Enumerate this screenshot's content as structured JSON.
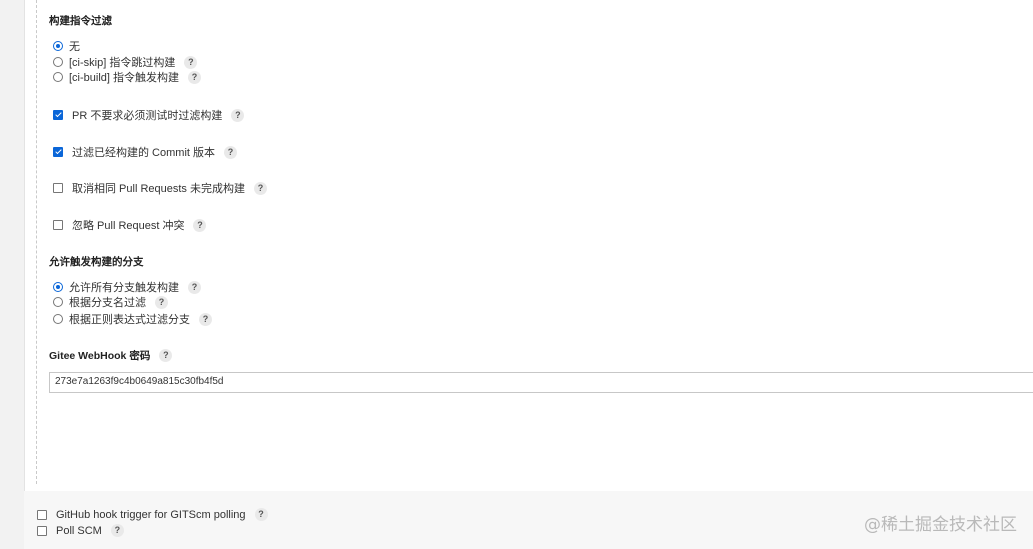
{
  "build_filter": {
    "title": "构建指令过滤",
    "options": [
      {
        "label": "无",
        "checked": true,
        "help": false
      },
      {
        "label": "[ci-skip] 指令跳过构建",
        "checked": false,
        "help": true
      },
      {
        "label": "[ci-build] 指令触发构建",
        "checked": false,
        "help": true
      }
    ]
  },
  "checkboxes": [
    {
      "label": "PR 不要求必须测试时过滤构建",
      "checked": true
    },
    {
      "label": "过滤已经构建的 Commit 版本",
      "checked": true
    },
    {
      "label": "取消相同 Pull Requests 未完成构建",
      "checked": false
    },
    {
      "label": "忽略 Pull Request 冲突",
      "checked": false
    }
  ],
  "branch_filter": {
    "title": "允许触发构建的分支",
    "options": [
      {
        "label": "允许所有分支触发构建",
        "checked": true
      },
      {
        "label": "根据分支名过滤",
        "checked": false
      },
      {
        "label": "根据正则表达式过滤分支",
        "checked": false
      }
    ]
  },
  "webhook": {
    "title": "Gitee WebHook 密码",
    "value": "273e7a1263f9c4b0649a815c30fb4f5d"
  },
  "triggers": [
    {
      "label": "GitHub hook trigger for GITScm polling",
      "checked": false
    },
    {
      "label": "Poll SCM",
      "checked": false
    }
  ],
  "help_symbol": "?",
  "watermark": "@稀土掘金技术社区"
}
